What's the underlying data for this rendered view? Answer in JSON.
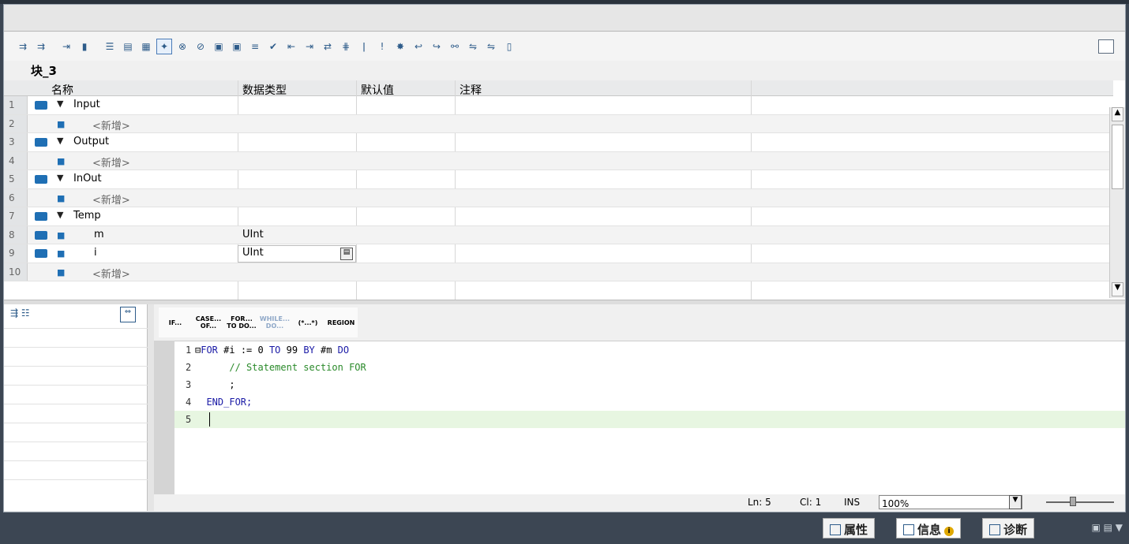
{
  "editor_title": "块_3",
  "grid": {
    "headers": [
      "名称",
      "数据类型",
      "默认值",
      "注释"
    ],
    "rows": [
      {
        "num": "1",
        "name": "Input",
        "type": "",
        "section": true
      },
      {
        "num": "2",
        "name": "<新增>",
        "type": "",
        "placeholder": true
      },
      {
        "num": "3",
        "name": "Output",
        "type": "",
        "section": true
      },
      {
        "num": "4",
        "name": "<新增>",
        "type": "",
        "placeholder": true
      },
      {
        "num": "5",
        "name": "InOut",
        "type": "",
        "section": true
      },
      {
        "num": "6",
        "name": "<新增>",
        "type": "",
        "placeholder": true
      },
      {
        "num": "7",
        "name": "Temp",
        "type": "",
        "section": true
      },
      {
        "num": "8",
        "name": "m",
        "type": "UInt",
        "var": true
      },
      {
        "num": "9",
        "name": "i",
        "type": "UInt",
        "var": true,
        "editing": true
      },
      {
        "num": "10",
        "name": "<新增>",
        "type": "",
        "placeholder": true
      }
    ]
  },
  "snippets": [
    "IF...",
    "CASE... OF...",
    "FOR... TO DO...",
    "WHILE... DO...",
    "(*...*)",
    "REGION"
  ],
  "code": {
    "lines": [
      {
        "num": "1",
        "prefix": "⊟",
        "kw1": "FOR",
        "rest": " #i := 0 ",
        "kw2": "TO",
        "rest2": " 99 ",
        "kw3": "BY",
        "rest3": " #m ",
        "kw4": "DO"
      },
      {
        "num": "2",
        "comment": "    // Statement section FOR"
      },
      {
        "num": "3",
        "plain": "    ;"
      },
      {
        "num": "4",
        "kwonly": " END_FOR;"
      },
      {
        "num": "5",
        "plain": ""
      }
    ]
  },
  "status": {
    "ln": "Ln: 5",
    "cl": "Cl: 1",
    "mode": "INS",
    "zoom": "100%"
  },
  "bottom_tabs": {
    "properties": "属性",
    "info": "信息",
    "diagnostics": "诊断"
  },
  "colors": {
    "accent": "#1f6fb4",
    "keyword": "#1a1aa6",
    "comment": "#2a8a2a",
    "current_line": "#e7f6e1"
  }
}
